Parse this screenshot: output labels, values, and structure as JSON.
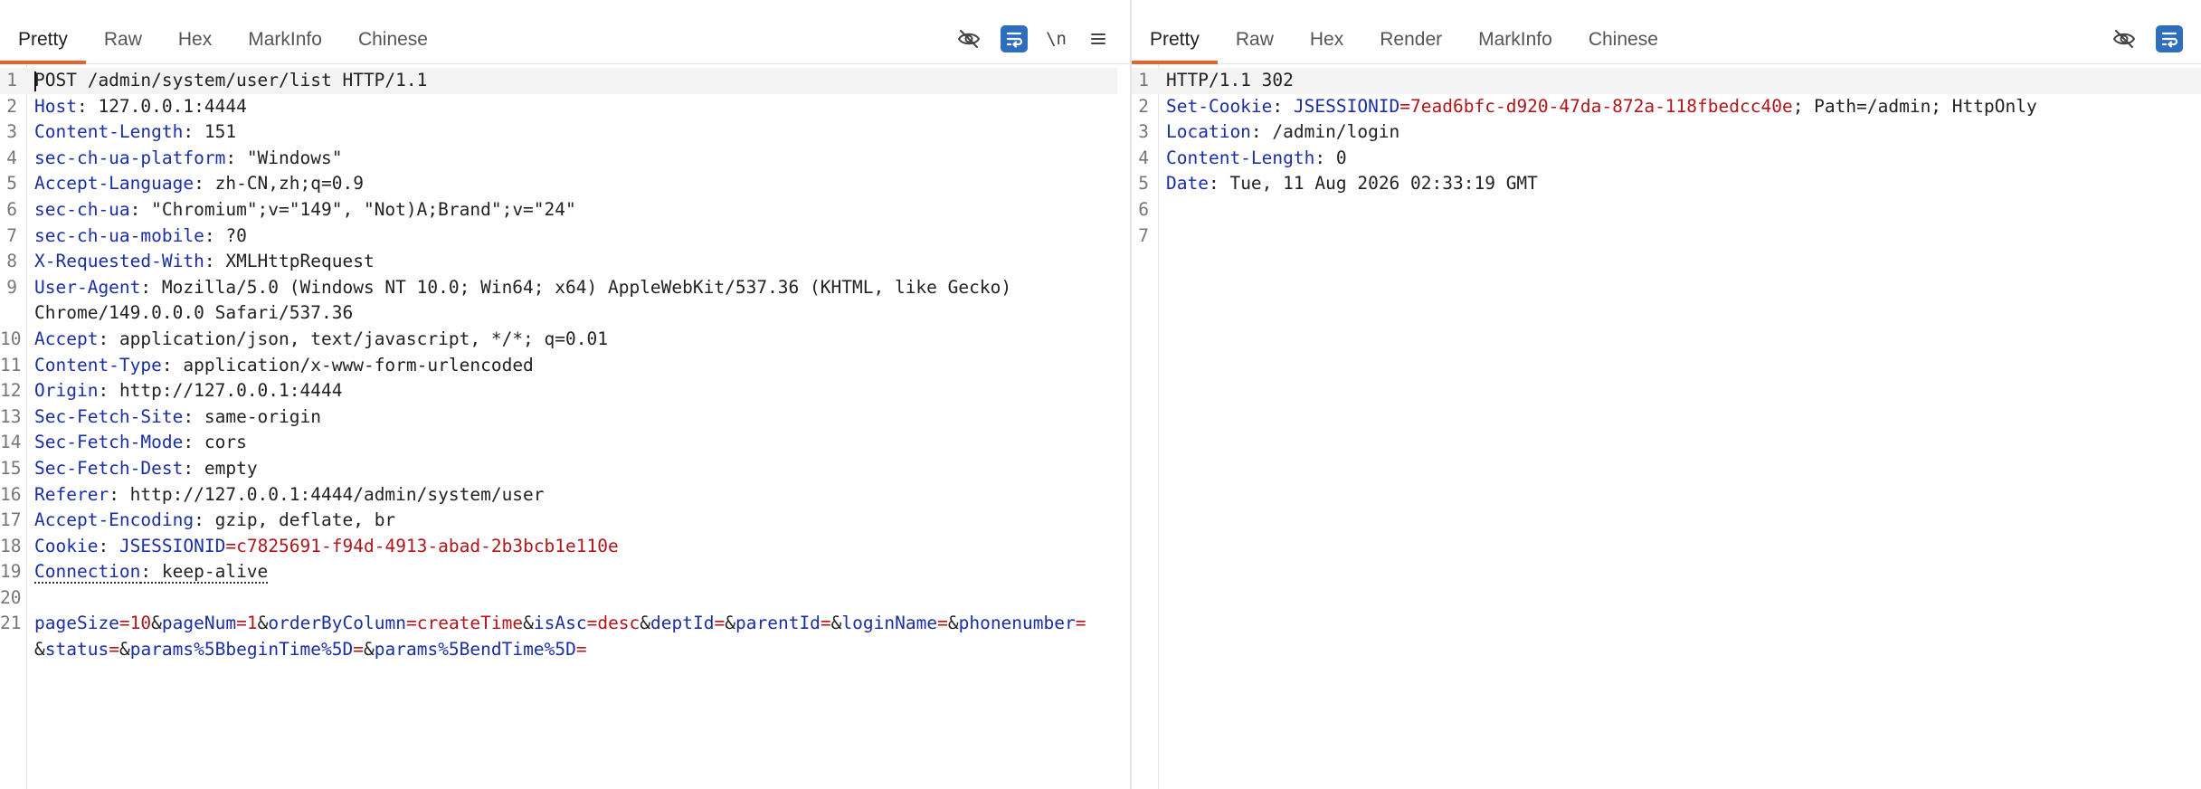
{
  "request": {
    "tabs": [
      "Pretty",
      "Raw",
      "Hex",
      "MarkInfo",
      "Chinese"
    ],
    "active_tab": "Pretty",
    "toolbar": {
      "newline_label": "\\n"
    },
    "lines": [
      {
        "n": "1",
        "text": "POST /admin/system/user/list HTTP/1.1"
      },
      {
        "n": "2",
        "name": "Host",
        "value": "127.0.0.1:4444"
      },
      {
        "n": "3",
        "name": "Content-Length",
        "value": "151"
      },
      {
        "n": "4",
        "name": "sec-ch-ua-platform",
        "value": "\"Windows\""
      },
      {
        "n": "5",
        "name": "Accept-Language",
        "value": "zh-CN,zh;q=0.9"
      },
      {
        "n": "6",
        "name": "sec-ch-ua",
        "value": "\"Chromium\";v=\"149\", \"Not)A;Brand\";v=\"24\""
      },
      {
        "n": "7",
        "name": "sec-ch-ua-mobile",
        "value": "?0"
      },
      {
        "n": "8",
        "name": "X-Requested-With",
        "value": "XMLHttpRequest"
      },
      {
        "n": "9",
        "name": "User-Agent",
        "value": "Mozilla/5.0 (Windows NT 10.0; Win64; x64) AppleWebKit/537.36 (KHTML, like Gecko)",
        "cont": "Chrome/149.0.0.0 Safari/537.36"
      },
      {
        "n": "10",
        "name": "Accept",
        "value": "application/json, text/javascript, */*; q=0.01"
      },
      {
        "n": "11",
        "name": "Content-Type",
        "value": "application/x-www-form-urlencoded"
      },
      {
        "n": "12",
        "name": "Origin",
        "value": "http://127.0.0.1:4444"
      },
      {
        "n": "13",
        "name": "Sec-Fetch-Site",
        "value": "same-origin"
      },
      {
        "n": "14",
        "name": "Sec-Fetch-Mode",
        "value": "cors"
      },
      {
        "n": "15",
        "name": "Sec-Fetch-Dest",
        "value": "empty"
      },
      {
        "n": "16",
        "name": "Referer",
        "value": "http://127.0.0.1:4444/admin/system/user"
      },
      {
        "n": "17",
        "name": "Accept-Encoding",
        "value": "gzip, deflate, br"
      },
      {
        "n": "18",
        "name": "Cookie",
        "cookie": {
          "name": "JSESSIONID",
          "value": "c7825691-f94d-4913-abad-2b3bcb1e110e"
        }
      },
      {
        "n": "19",
        "name": "Connection",
        "value": "keep-alive",
        "dotted": true
      },
      {
        "n": "20",
        "text": ""
      },
      {
        "n": "21",
        "params": [
          [
            "pageSize",
            "10"
          ],
          [
            "pageNum",
            "1"
          ],
          [
            "orderByColumn",
            "createTime"
          ],
          [
            "isAsc",
            "desc"
          ],
          [
            "deptId",
            ""
          ],
          [
            "parentId",
            ""
          ],
          [
            "loginName",
            ""
          ],
          [
            "phonenumber",
            ""
          ]
        ],
        "cont_params": [
          [
            "status",
            ""
          ],
          [
            "params%5BbeginTime%5D",
            ""
          ],
          [
            "params%5BendTime%5D",
            ""
          ]
        ]
      }
    ]
  },
  "response": {
    "tabs": [
      "Pretty",
      "Raw",
      "Hex",
      "Render",
      "MarkInfo",
      "Chinese"
    ],
    "active_tab": "Pretty",
    "lines": [
      {
        "n": "1",
        "text": "HTTP/1.1 302"
      },
      {
        "n": "2",
        "name": "Set-Cookie",
        "cookie": {
          "name": "JSESSIONID",
          "value": "7ead6bfc-d920-47da-872a-118fbedcc40e"
        },
        "suffix": "; Path=/admin; HttpOnly"
      },
      {
        "n": "3",
        "name": "Location",
        "value": "/admin/login"
      },
      {
        "n": "4",
        "name": "Content-Length",
        "value": "0"
      },
      {
        "n": "5",
        "name": "Date",
        "value": "Tue, 11 Aug 2026 02:33:19 GMT"
      },
      {
        "n": "6",
        "text": ""
      },
      {
        "n": "7",
        "text": ""
      }
    ]
  }
}
